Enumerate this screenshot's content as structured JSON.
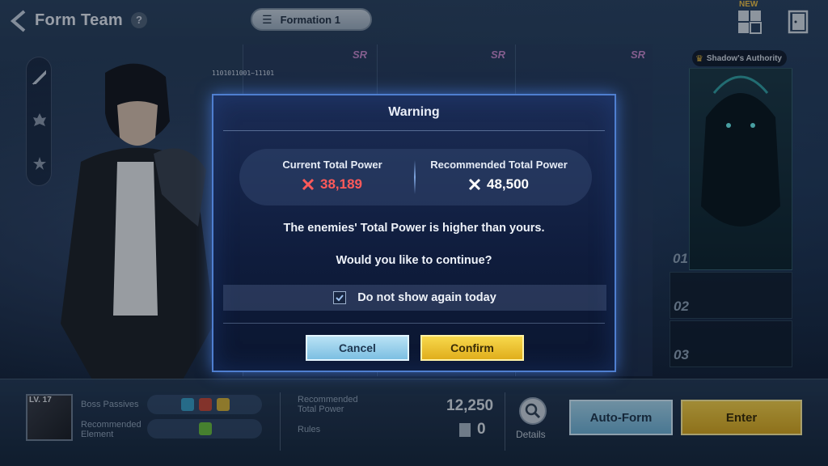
{
  "header": {
    "title": "Form Team",
    "help": "?",
    "formation_label": "Formation 1",
    "new_badge": "NEW"
  },
  "cards": {
    "rank_labels": [
      "SR",
      "SR",
      "SR",
      "SR"
    ],
    "binary_text": "1101011001~11101"
  },
  "shadow": {
    "authority_label": "Shadow's Authority",
    "slots": [
      "01",
      "02",
      "03"
    ]
  },
  "bottom": {
    "boss_level": "LV. 17",
    "boss_passives_label": "Boss Passives",
    "recommended_element_label": "Recommended Element",
    "recommended_power_label": "Recommended Total Power",
    "recommended_power_value": "12,250",
    "rules_label": "Rules",
    "rules_count": "0",
    "details_label": "Details",
    "auto_form_label": "Auto-Form",
    "enter_label": "Enter"
  },
  "modal": {
    "title": "Warning",
    "current_power_label": "Current Total Power",
    "current_power_value": "38,189",
    "recommended_power_label": "Recommended Total Power",
    "recommended_power_value": "48,500",
    "message_1": "The enemies' Total Power is higher than yours.",
    "message_2": "Would you like to continue?",
    "checkbox_label": "Do not show again today",
    "checkbox_checked": true,
    "cancel_label": "Cancel",
    "confirm_label": "Confirm"
  },
  "colors": {
    "current_power": "#ff5a5a",
    "recommended_power": "#ffffff",
    "confirm": "#f0c232",
    "cancel": "#9fd2ee",
    "modal_border": "#4f7fd0"
  }
}
